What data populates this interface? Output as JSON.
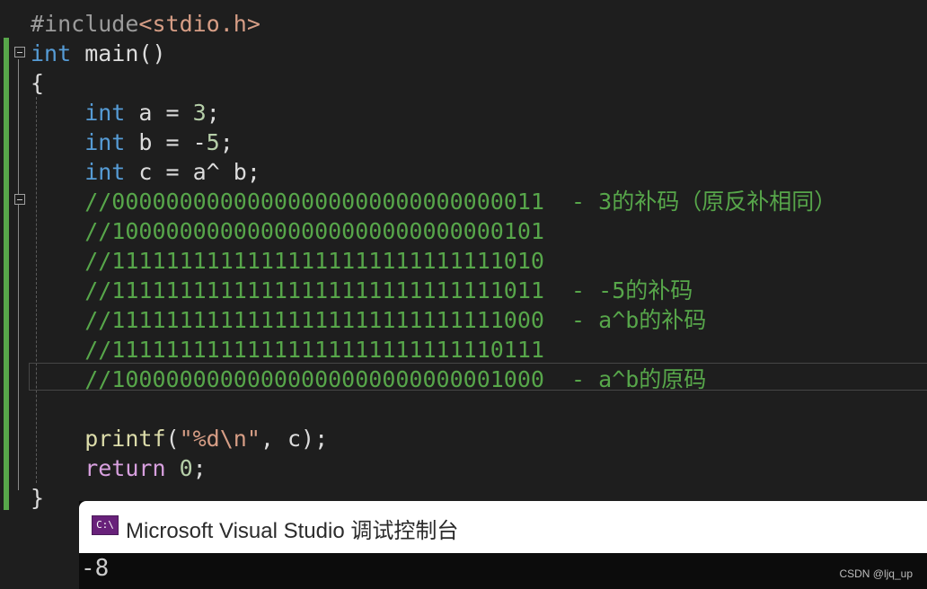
{
  "editor": {
    "lines": [
      {
        "tokens": [
          {
            "t": "#include",
            "c": "pp"
          },
          {
            "t": "<stdio.h>",
            "c": "inc"
          }
        ]
      },
      {
        "tokens": [
          {
            "t": "int",
            "c": "kw"
          },
          {
            "t": " main()",
            "c": "id"
          }
        ]
      },
      {
        "tokens": [
          {
            "t": "{",
            "c": "id"
          }
        ]
      },
      {
        "tokens": [
          {
            "t": "    int",
            "c": "kw"
          },
          {
            "t": " a = ",
            "c": "id"
          },
          {
            "t": "3",
            "c": "num"
          },
          {
            "t": ";",
            "c": "id"
          }
        ]
      },
      {
        "tokens": [
          {
            "t": "    int",
            "c": "kw"
          },
          {
            "t": " b = -",
            "c": "id"
          },
          {
            "t": "5",
            "c": "num"
          },
          {
            "t": ";",
            "c": "id"
          }
        ]
      },
      {
        "tokens": [
          {
            "t": "    int",
            "c": "kw"
          },
          {
            "t": " c = a^ b;",
            "c": "id"
          }
        ]
      },
      {
        "tokens": [
          {
            "t": "    //00000000000000000000000000000011  - 3的补码（原反补相同）",
            "c": "cm"
          }
        ]
      },
      {
        "tokens": [
          {
            "t": "    //10000000000000000000000000000101",
            "c": "cm"
          }
        ]
      },
      {
        "tokens": [
          {
            "t": "    //11111111111111111111111111111010",
            "c": "cm"
          }
        ]
      },
      {
        "tokens": [
          {
            "t": "    //11111111111111111111111111111011  - -5的补码",
            "c": "cm"
          }
        ]
      },
      {
        "tokens": [
          {
            "t": "    //11111111111111111111111111111000  - a^b的补码",
            "c": "cm"
          }
        ]
      },
      {
        "tokens": [
          {
            "t": "    //11111111111111111111111111110111",
            "c": "cm"
          }
        ]
      },
      {
        "tokens": [
          {
            "t": "    //10000000000000000000000000001000  - a^b的原码",
            "c": "cm"
          }
        ]
      },
      {
        "tokens": [
          {
            "t": "",
            "c": "id"
          }
        ]
      },
      {
        "tokens": [
          {
            "t": "    printf",
            "c": "fn"
          },
          {
            "t": "(",
            "c": "id"
          },
          {
            "t": "\"%d\\n\"",
            "c": "str"
          },
          {
            "t": ", c);",
            "c": "id"
          }
        ]
      },
      {
        "tokens": [
          {
            "t": "    return",
            "c": "ret"
          },
          {
            "t": " ",
            "c": "id"
          },
          {
            "t": "0",
            "c": "num"
          },
          {
            "t": ";",
            "c": "id"
          }
        ]
      },
      {
        "tokens": [
          {
            "t": "}",
            "c": "id"
          }
        ]
      }
    ]
  },
  "console": {
    "icon_label": "C:\\",
    "icon_name": "console-app-icon",
    "title": "Microsoft Visual Studio 调试控制台",
    "output": "-8"
  },
  "watermark": "CSDN @ljq_up",
  "colors": {
    "background": "#1e1e1e",
    "keyword": "#569cd6",
    "comment": "#57a64a",
    "number": "#b5cea8",
    "string": "#d69d85",
    "function": "#dcdcaa",
    "control": "#d8a0df"
  }
}
